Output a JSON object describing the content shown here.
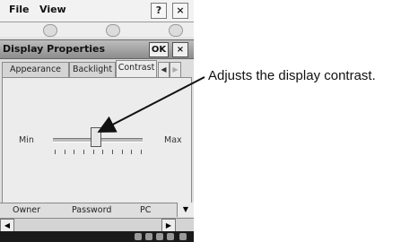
{
  "menubar": {
    "file_label": "File",
    "view_label": "View",
    "help_label": "?",
    "close_label": "×"
  },
  "dialog": {
    "title": "Display Properties",
    "ok_label": "OK",
    "close_label": "×",
    "tabs": [
      {
        "label": "Appearance"
      },
      {
        "label": "Backlight"
      },
      {
        "label": "Contrast"
      }
    ],
    "tab_scroll_left": "◀",
    "tab_scroll_right": "▶",
    "contrast": {
      "min_label": "Min",
      "max_label": "Max",
      "level": 0.47,
      "tick_count": 10
    }
  },
  "bottom_tabs": [
    {
      "label": "Owner"
    },
    {
      "label": "Password"
    },
    {
      "label": "PC"
    }
  ],
  "scroll": {
    "down_arrow": "▼",
    "left_arrow": "◀",
    "right_arrow": "▶"
  },
  "callout": {
    "text": "Adjusts the display contrast."
  },
  "colors": {
    "titlebar": "#8c8c8c",
    "panel": "#ececec",
    "taskbar": "#1a1a1a"
  }
}
